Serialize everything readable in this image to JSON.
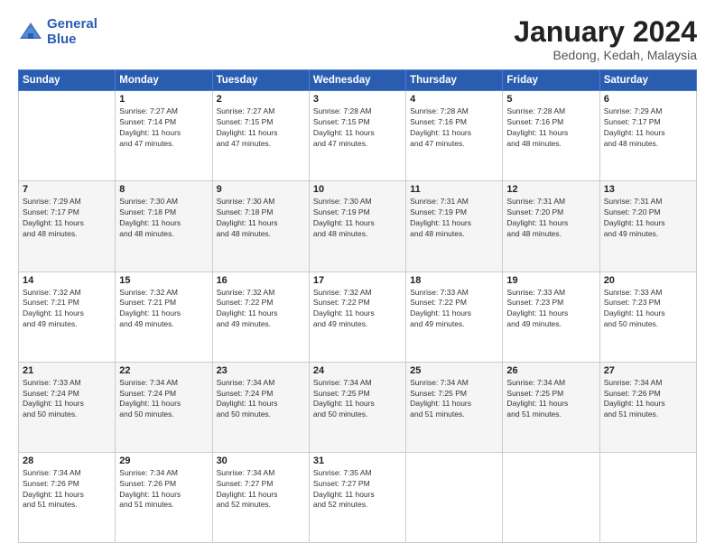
{
  "header": {
    "logo_line1": "General",
    "logo_line2": "Blue",
    "month": "January 2024",
    "location": "Bedong, Kedah, Malaysia"
  },
  "weekdays": [
    "Sunday",
    "Monday",
    "Tuesday",
    "Wednesday",
    "Thursday",
    "Friday",
    "Saturday"
  ],
  "weeks": [
    [
      {
        "day": "",
        "info": ""
      },
      {
        "day": "1",
        "info": "Sunrise: 7:27 AM\nSunset: 7:14 PM\nDaylight: 11 hours\nand 47 minutes."
      },
      {
        "day": "2",
        "info": "Sunrise: 7:27 AM\nSunset: 7:15 PM\nDaylight: 11 hours\nand 47 minutes."
      },
      {
        "day": "3",
        "info": "Sunrise: 7:28 AM\nSunset: 7:15 PM\nDaylight: 11 hours\nand 47 minutes."
      },
      {
        "day": "4",
        "info": "Sunrise: 7:28 AM\nSunset: 7:16 PM\nDaylight: 11 hours\nand 47 minutes."
      },
      {
        "day": "5",
        "info": "Sunrise: 7:28 AM\nSunset: 7:16 PM\nDaylight: 11 hours\nand 48 minutes."
      },
      {
        "day": "6",
        "info": "Sunrise: 7:29 AM\nSunset: 7:17 PM\nDaylight: 11 hours\nand 48 minutes."
      }
    ],
    [
      {
        "day": "7",
        "info": "Sunrise: 7:29 AM\nSunset: 7:17 PM\nDaylight: 11 hours\nand 48 minutes."
      },
      {
        "day": "8",
        "info": "Sunrise: 7:30 AM\nSunset: 7:18 PM\nDaylight: 11 hours\nand 48 minutes."
      },
      {
        "day": "9",
        "info": "Sunrise: 7:30 AM\nSunset: 7:18 PM\nDaylight: 11 hours\nand 48 minutes."
      },
      {
        "day": "10",
        "info": "Sunrise: 7:30 AM\nSunset: 7:19 PM\nDaylight: 11 hours\nand 48 minutes."
      },
      {
        "day": "11",
        "info": "Sunrise: 7:31 AM\nSunset: 7:19 PM\nDaylight: 11 hours\nand 48 minutes."
      },
      {
        "day": "12",
        "info": "Sunrise: 7:31 AM\nSunset: 7:20 PM\nDaylight: 11 hours\nand 48 minutes."
      },
      {
        "day": "13",
        "info": "Sunrise: 7:31 AM\nSunset: 7:20 PM\nDaylight: 11 hours\nand 49 minutes."
      }
    ],
    [
      {
        "day": "14",
        "info": "Sunrise: 7:32 AM\nSunset: 7:21 PM\nDaylight: 11 hours\nand 49 minutes."
      },
      {
        "day": "15",
        "info": "Sunrise: 7:32 AM\nSunset: 7:21 PM\nDaylight: 11 hours\nand 49 minutes."
      },
      {
        "day": "16",
        "info": "Sunrise: 7:32 AM\nSunset: 7:22 PM\nDaylight: 11 hours\nand 49 minutes."
      },
      {
        "day": "17",
        "info": "Sunrise: 7:32 AM\nSunset: 7:22 PM\nDaylight: 11 hours\nand 49 minutes."
      },
      {
        "day": "18",
        "info": "Sunrise: 7:33 AM\nSunset: 7:22 PM\nDaylight: 11 hours\nand 49 minutes."
      },
      {
        "day": "19",
        "info": "Sunrise: 7:33 AM\nSunset: 7:23 PM\nDaylight: 11 hours\nand 49 minutes."
      },
      {
        "day": "20",
        "info": "Sunrise: 7:33 AM\nSunset: 7:23 PM\nDaylight: 11 hours\nand 50 minutes."
      }
    ],
    [
      {
        "day": "21",
        "info": "Sunrise: 7:33 AM\nSunset: 7:24 PM\nDaylight: 11 hours\nand 50 minutes."
      },
      {
        "day": "22",
        "info": "Sunrise: 7:34 AM\nSunset: 7:24 PM\nDaylight: 11 hours\nand 50 minutes."
      },
      {
        "day": "23",
        "info": "Sunrise: 7:34 AM\nSunset: 7:24 PM\nDaylight: 11 hours\nand 50 minutes."
      },
      {
        "day": "24",
        "info": "Sunrise: 7:34 AM\nSunset: 7:25 PM\nDaylight: 11 hours\nand 50 minutes."
      },
      {
        "day": "25",
        "info": "Sunrise: 7:34 AM\nSunset: 7:25 PM\nDaylight: 11 hours\nand 51 minutes."
      },
      {
        "day": "26",
        "info": "Sunrise: 7:34 AM\nSunset: 7:25 PM\nDaylight: 11 hours\nand 51 minutes."
      },
      {
        "day": "27",
        "info": "Sunrise: 7:34 AM\nSunset: 7:26 PM\nDaylight: 11 hours\nand 51 minutes."
      }
    ],
    [
      {
        "day": "28",
        "info": "Sunrise: 7:34 AM\nSunset: 7:26 PM\nDaylight: 11 hours\nand 51 minutes."
      },
      {
        "day": "29",
        "info": "Sunrise: 7:34 AM\nSunset: 7:26 PM\nDaylight: 11 hours\nand 51 minutes."
      },
      {
        "day": "30",
        "info": "Sunrise: 7:34 AM\nSunset: 7:27 PM\nDaylight: 11 hours\nand 52 minutes."
      },
      {
        "day": "31",
        "info": "Sunrise: 7:35 AM\nSunset: 7:27 PM\nDaylight: 11 hours\nand 52 minutes."
      },
      {
        "day": "",
        "info": ""
      },
      {
        "day": "",
        "info": ""
      },
      {
        "day": "",
        "info": ""
      }
    ]
  ]
}
